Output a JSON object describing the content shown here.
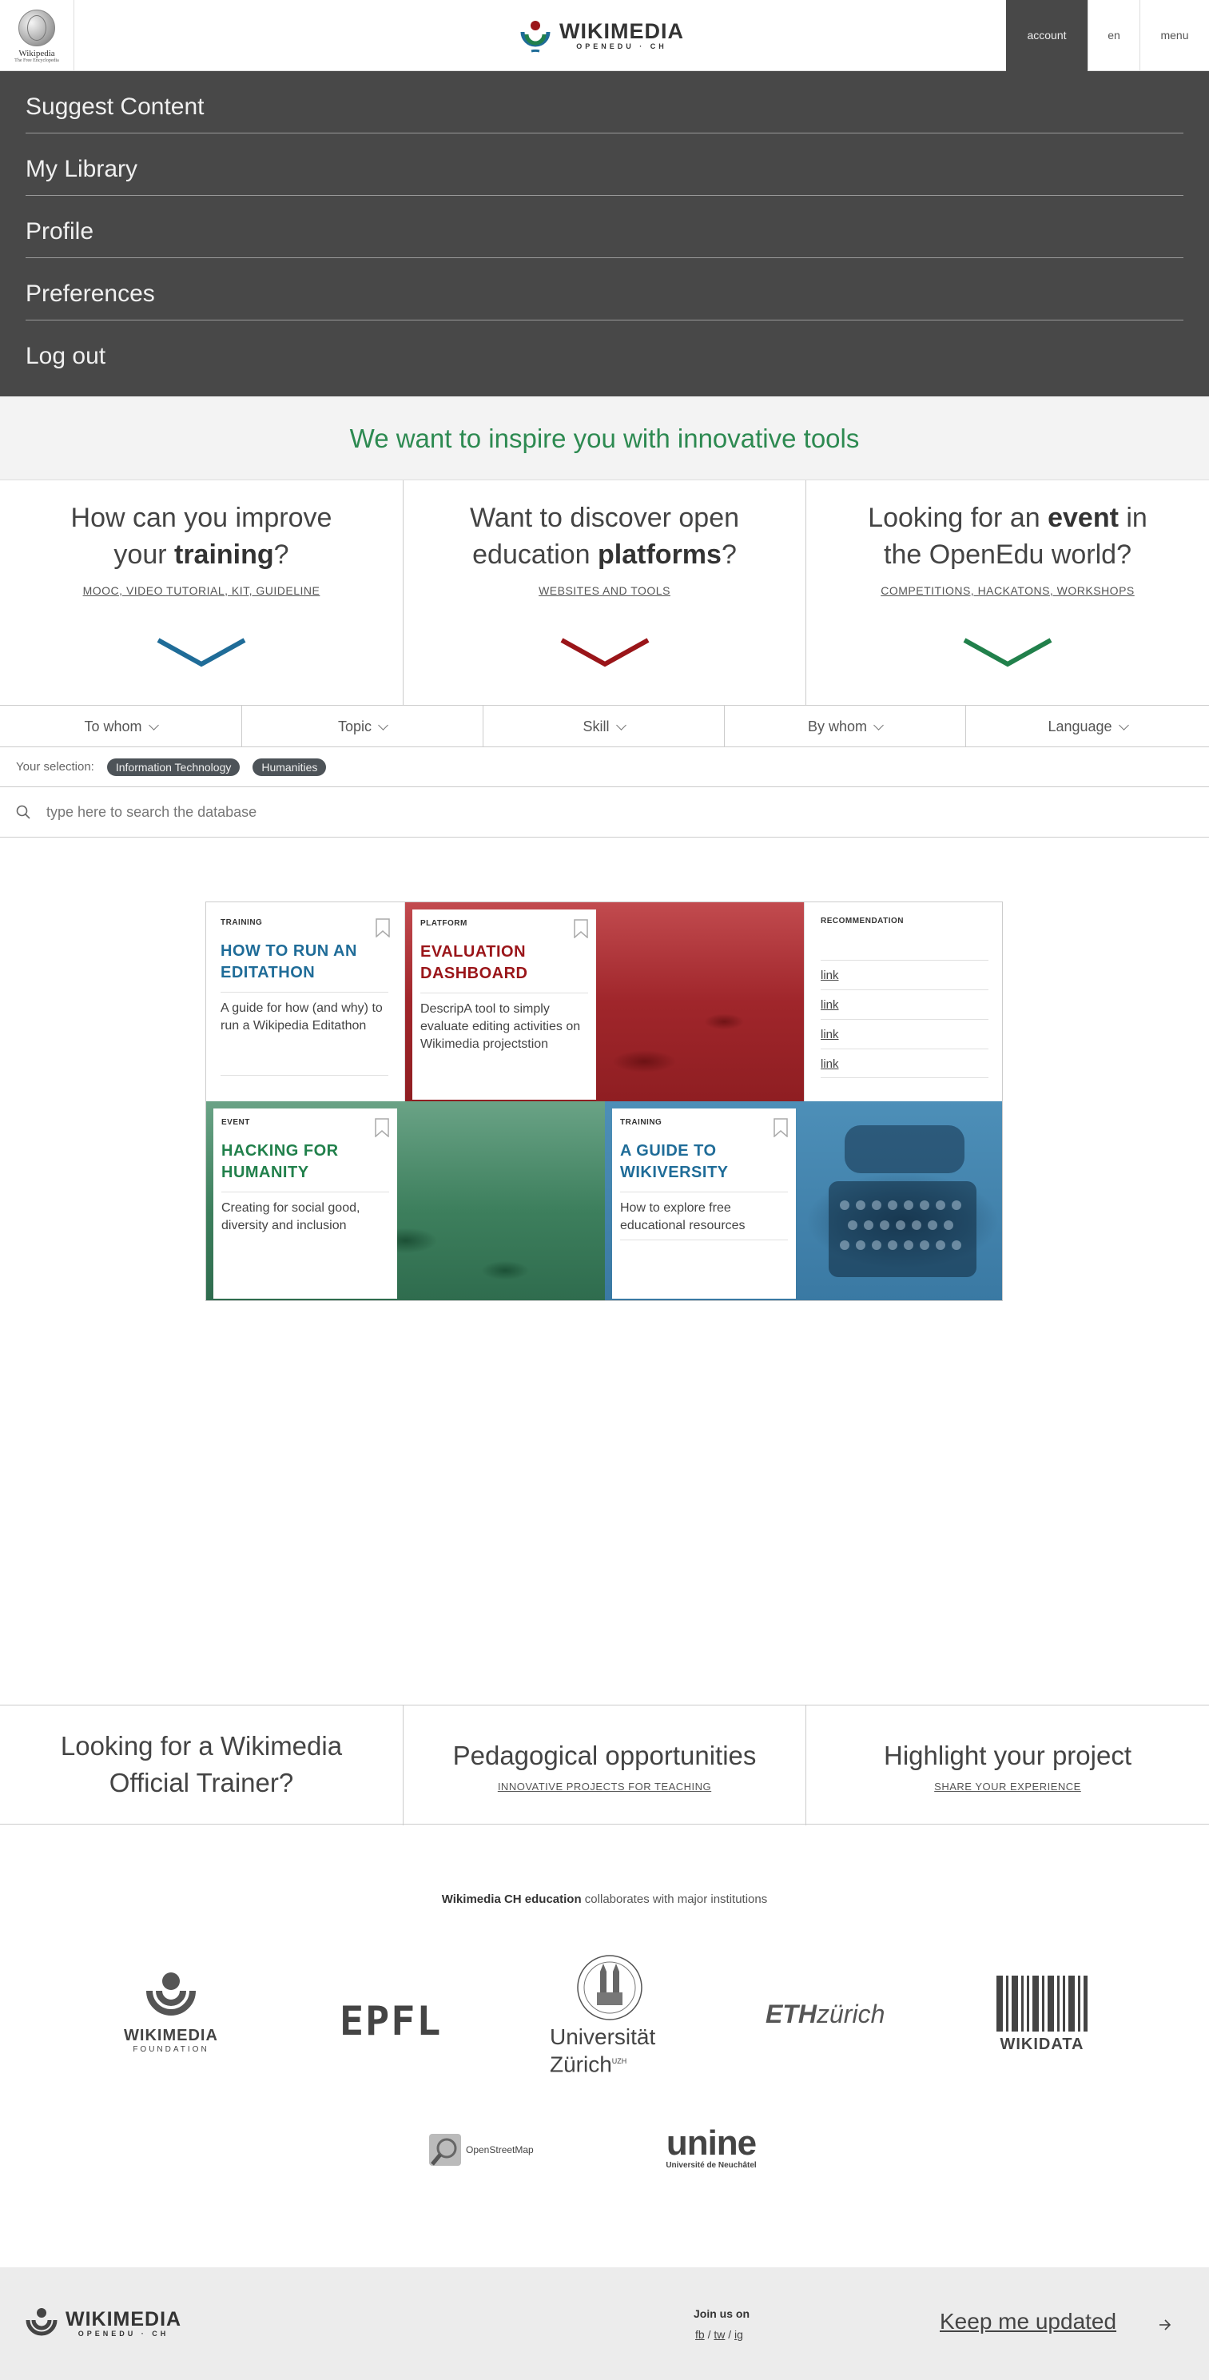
{
  "header": {
    "wp_title": "Wikipedia",
    "wp_subtitle": "The Free Encyclopedia",
    "brand_name": "WIKIMEDIA",
    "brand_sub": "OPENEDU · CH",
    "account_label": "account",
    "lang_label": "en",
    "menu_label": "menu"
  },
  "account_menu": {
    "items": [
      "Suggest Content",
      "My Library",
      "Profile",
      "Preferences",
      "Log out"
    ]
  },
  "hero": {
    "text": "We want to inspire you with innovative tools"
  },
  "columns": [
    {
      "pre": "How can you improve your ",
      "bold": "training",
      "post": "?",
      "link": "MOOC, VIDEO TUTORIAL, KIT, GUIDELINE",
      "color": "#1f6c98"
    },
    {
      "pre": "Want to discover open education ",
      "bold": "platforms",
      "post": "?",
      "link": "WEBSITES AND TOOLS",
      "color": "#9a1519"
    },
    {
      "pre": "Looking for an ",
      "bold": "event",
      "post": " in the OpenEdu world?",
      "link": "COMPETITIONS, HACKATONS, WORKSHOPS",
      "color": "#21804b"
    }
  ],
  "filters": [
    "To whom",
    "Topic",
    "Skill",
    "By whom",
    "Language"
  ],
  "selection": {
    "label": "Your selection:",
    "chips": [
      "Information Technology",
      "Humanities"
    ]
  },
  "search": {
    "placeholder": "type here to search the database"
  },
  "cards": [
    {
      "type": "TRAINING",
      "title": "HOW TO RUN AN EDITATHON",
      "desc": "A guide for how (and why) to run a Wikipedia Editathon",
      "color": "#1f6c98"
    },
    {
      "type": "PLATFORM",
      "title": "EVALUATION DASHBOARD",
      "desc": "DescripA tool to simply evaluate editing activities on Wikimedia projectstion",
      "color": "#9a1519"
    },
    {
      "type": "EVENT",
      "title": "HACKING FOR HUMANITY",
      "desc": "Creating for social good, diversity and inclusion",
      "color": "#21804b"
    },
    {
      "type": "TRAINING",
      "title": "A GUIDE TO WIKIVERSITY",
      "desc": "How to explore free educational resources",
      "color": "#1f6c98"
    }
  ],
  "recommendation": {
    "title": "RECOMMENDATION",
    "links": [
      "link",
      "link",
      "link",
      "link"
    ]
  },
  "bottom_columns": [
    {
      "title": "Looking for a Wikimedia Official Trainer?",
      "link": ""
    },
    {
      "title": "Pedagogical opportunities",
      "link": "INNOVATIVE PROJECTS FOR TEACHING"
    },
    {
      "title": "Highlight your project",
      "link": "SHARE YOUR EXPERIENCE"
    }
  ],
  "collab": {
    "bold": "Wikimedia CH education",
    "rest": " collaborates with major institutions"
  },
  "partners": {
    "wmf": {
      "name": "WIKIMEDIA",
      "sub": "FOUNDATION"
    },
    "epfl": "EPFL",
    "uzh": {
      "line1": "Universität",
      "line2": "Zürich",
      "sup": "UZH"
    },
    "eth": {
      "bold": "ETH",
      "rest": "zürich"
    },
    "wikidata": "WIKIDATA",
    "osm": "OpenStreetMap",
    "unine": {
      "name": "unine",
      "sub": "Université de Neuchâtel"
    }
  },
  "footer": {
    "brand_name": "WIKIMEDIA",
    "brand_sub": "OPENEDU · CH",
    "join": "Join us on",
    "social": [
      "fb",
      "tw",
      "ig"
    ],
    "keep": "Keep me updated"
  }
}
